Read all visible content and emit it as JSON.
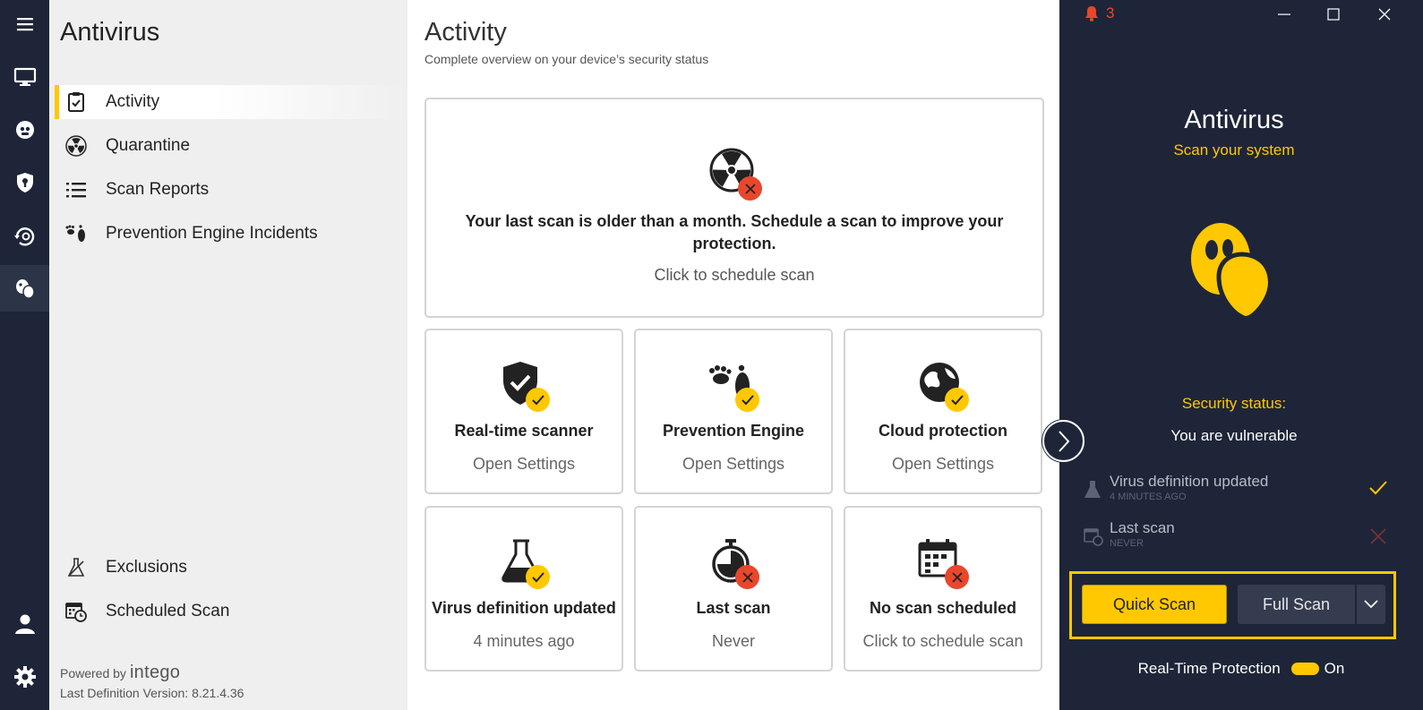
{
  "rail": {
    "items": [
      {
        "name": "menu-icon"
      },
      {
        "name": "monitor-icon"
      },
      {
        "name": "privacy-icon"
      },
      {
        "name": "shield-icon"
      },
      {
        "name": "backup-icon"
      },
      {
        "name": "antivirus-icon"
      },
      {
        "name": "user-icon"
      },
      {
        "name": "gear-icon"
      }
    ]
  },
  "sidebar": {
    "title": "Antivirus",
    "items": [
      {
        "label": "Activity",
        "icon": "clipboard-check-icon",
        "active": true
      },
      {
        "label": "Quarantine",
        "icon": "radiation-icon"
      },
      {
        "label": "Scan Reports",
        "icon": "list-icon"
      },
      {
        "label": "Prevention Engine Incidents",
        "icon": "footprints-icon"
      }
    ],
    "bottom_items": [
      {
        "label": "Exclusions",
        "icon": "flask-icon"
      },
      {
        "label": "Scheduled Scan",
        "icon": "calendar-clock-icon"
      }
    ],
    "powered_by": "Powered by",
    "brand": "intego",
    "definition_version": "Last Definition Version:  8.21.4.36"
  },
  "main": {
    "title": "Activity",
    "subtitle": "Complete overview on your device’s security status",
    "alert_card": {
      "message": "Your last scan is older than a month. Schedule a scan to improve your protection.",
      "link": "Click to schedule scan"
    },
    "cards": [
      {
        "title": "Real-time scanner",
        "sub": "Open Settings",
        "status": "ok",
        "icon": "shield-check-icon"
      },
      {
        "title": "Prevention Engine",
        "sub": "Open Settings",
        "status": "ok",
        "icon": "footprints-icon"
      },
      {
        "title": "Cloud protection",
        "sub": "Open Settings",
        "status": "ok",
        "icon": "globe-icon"
      },
      {
        "title": "Virus definition updated",
        "sub": "4 minutes ago",
        "status": "ok",
        "icon": "flask-icon"
      },
      {
        "title": "Last scan",
        "sub": "Never",
        "status": "error",
        "icon": "stopwatch-icon"
      },
      {
        "title": "No scan scheduled",
        "sub": "Click to schedule scan",
        "status": "error",
        "icon": "calendar-clock-icon"
      }
    ]
  },
  "right": {
    "notifications": "3",
    "title": "Antivirus",
    "subtitle": "Scan your system",
    "security_label": "Security status:",
    "security_value": "You are vulnerable",
    "status_items": [
      {
        "name": "Virus definition updated",
        "detail": "4 MINUTES AGO",
        "ok": true
      },
      {
        "name": "Last scan",
        "detail": "NEVER",
        "ok": false
      }
    ],
    "quick_scan": "Quick Scan",
    "full_scan": "Full Scan",
    "rtp_label": "Real-Time Protection",
    "rtp_state": "On"
  },
  "colors": {
    "accent": "#ffc800",
    "error": "#e8472c",
    "dark": "#1e2538"
  }
}
